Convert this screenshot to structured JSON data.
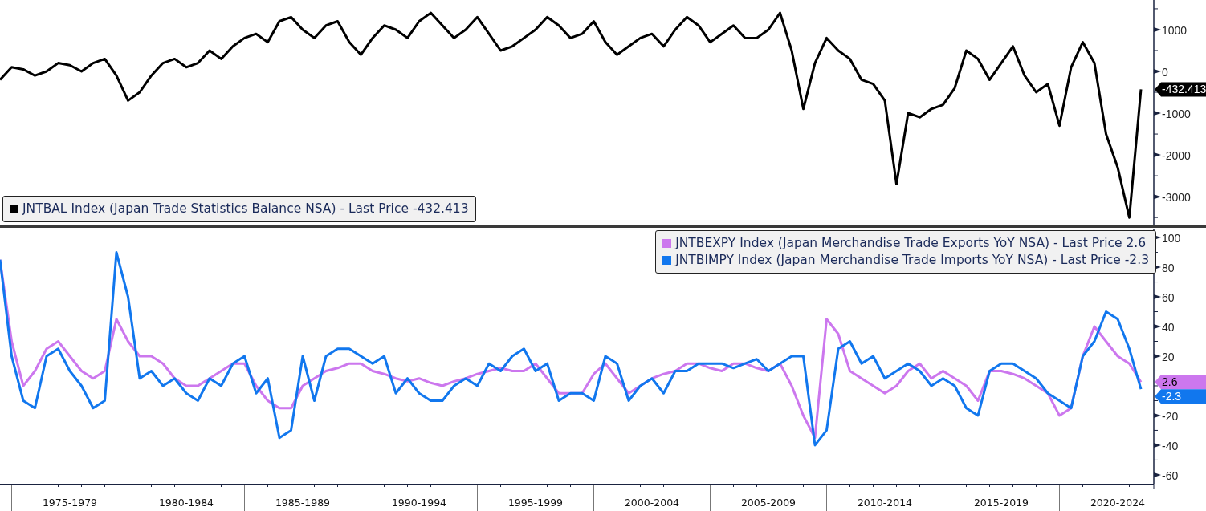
{
  "top_panel": {
    "legend": [
      {
        "text": "(Japan Trade Statistics Balance NSA) - Last Price -432.413"
      }
    ],
    "last_price_tags": [
      {
        "text": "-432.413",
        "color": "#000000"
      }
    ],
    "chart_data": {
      "type": "line",
      "categories": [
        null,
        null,
        null,
        null,
        null,
        null,
        null,
        null,
        null,
        null,
        null,
        null,
        null,
        null,
        null,
        null,
        null,
        null,
        null,
        null,
        null,
        null,
        null,
        null,
        null,
        null,
        null,
        null,
        null,
        null,
        null,
        null,
        null,
        null,
        null,
        null,
        null,
        null,
        null,
        null,
        null,
        null,
        null,
        null,
        null,
        null,
        null,
        null,
        null,
        null,
        null,
        null,
        null,
        null,
        null,
        null,
        null,
        null,
        null,
        null,
        null,
        null,
        null,
        null,
        null,
        null,
        null,
        null,
        null,
        null,
        null,
        null,
        null,
        null,
        null,
        null,
        null,
        null,
        null,
        null,
        null,
        null,
        null,
        null,
        null,
        null,
        null,
        null,
        null,
        null,
        null,
        null,
        null,
        null,
        null,
        null,
        null,
        null,
        null
      ],
      "series": [
        {
          "name": "JNTBAL Index",
          "color": "#000000",
          "values": [
            -200,
            100,
            50,
            -100,
            0,
            200,
            150,
            0,
            200,
            300,
            -100,
            -700,
            -500,
            -100,
            200,
            300,
            100,
            200,
            500,
            300,
            600,
            800,
            900,
            700,
            1200,
            1300,
            1000,
            800,
            1100,
            1200,
            700,
            400,
            800,
            1100,
            1000,
            800,
            1200,
            1400,
            1100,
            800,
            1000,
            1300,
            900,
            500,
            600,
            800,
            1000,
            1300,
            1100,
            800,
            900,
            1200,
            700,
            400,
            600,
            800,
            900,
            600,
            1000,
            1300,
            1100,
            700,
            900,
            1100,
            800,
            800,
            1000,
            1400,
            500,
            -900,
            200,
            800,
            500,
            300,
            -200,
            -300,
            -700,
            -2700,
            -1000,
            -1100,
            -900,
            -800,
            -400,
            500,
            300,
            -200,
            200,
            600,
            -100,
            -500,
            -300,
            -1300,
            100,
            700,
            200,
            -1500,
            -2300,
            -3500,
            -430
          ]
        }
      ],
      "ylim": [
        -3670,
        1710
      ],
      "yticks": [
        1000,
        0,
        -1000,
        -2000,
        -3000
      ]
    }
  },
  "bottom_panel": {
    "legend": [
      {
        "text": "(Japan Merchandise Trade Exports YoY NSA) - Last Price 2.6"
      },
      {
        "text": "(Japan Merchandise Trade Imports YoY NSA) - Last Price -2.3"
      }
    ],
    "last_price_tags": [
      {
        "text": "2.6",
        "color": "#cc77ee"
      },
      {
        "text": "-2.3",
        "color": "#1177ee"
      }
    ],
    "chart_data": {
      "type": "line",
      "categories": [
        null,
        null,
        null,
        null,
        null,
        null,
        "1975-1979",
        null,
        null,
        null,
        null,
        null,
        null,
        null,
        null,
        null,
        "1980-1984",
        null,
        null,
        null,
        null,
        null,
        null,
        null,
        null,
        null,
        "1985-1989",
        null,
        null,
        null,
        null,
        null,
        null,
        null,
        null,
        null,
        "1990-1994",
        null,
        null,
        null,
        null,
        null,
        null,
        null,
        null,
        null,
        "1995-1999",
        null,
        null,
        null,
        null,
        null,
        null,
        null,
        null,
        null,
        "2000-2004",
        null,
        null,
        null,
        null,
        null,
        null,
        null,
        null,
        null,
        "2005-2009",
        null,
        null,
        null,
        null,
        null,
        null,
        null,
        null,
        null,
        "2010-2014",
        null,
        null,
        null,
        null,
        null,
        null,
        null,
        null,
        null,
        "2015-2019",
        null,
        null,
        null,
        null,
        null,
        null,
        null,
        null,
        null,
        "2020-2024",
        null,
        null
      ],
      "series": [
        {
          "name": "JNTBEXPY Index",
          "color": "#cc77ee",
          "values": [
            85,
            30,
            0,
            10,
            25,
            30,
            20,
            10,
            5,
            10,
            45,
            30,
            20,
            20,
            15,
            5,
            0,
            0,
            5,
            10,
            15,
            15,
            0,
            -10,
            -15,
            -15,
            0,
            5,
            10,
            12,
            15,
            15,
            10,
            8,
            5,
            3,
            5,
            2,
            0,
            3,
            5,
            8,
            10,
            12,
            10,
            10,
            15,
            5,
            -5,
            -5,
            -5,
            8,
            15,
            5,
            -5,
            0,
            5,
            8,
            10,
            15,
            15,
            12,
            10,
            15,
            15,
            12,
            10,
            15,
            0,
            -20,
            -35,
            45,
            35,
            10,
            5,
            0,
            -5,
            0,
            10,
            15,
            5,
            10,
            5,
            0,
            -10,
            10,
            10,
            8,
            5,
            0,
            -5,
            -20,
            -15,
            20,
            40,
            30,
            20,
            15,
            2.6
          ]
        },
        {
          "name": "JNTBIMPY Index",
          "color": "#1177ee",
          "values": [
            85,
            20,
            -10,
            -15,
            20,
            25,
            10,
            0,
            -15,
            -10,
            90,
            60,
            5,
            10,
            0,
            5,
            -5,
            -10,
            5,
            0,
            15,
            20,
            -5,
            5,
            -35,
            -30,
            20,
            -10,
            20,
            25,
            25,
            20,
            15,
            20,
            -5,
            5,
            -5,
            -10,
            -10,
            0,
            5,
            0,
            15,
            10,
            20,
            25,
            10,
            15,
            -10,
            -5,
            -5,
            -10,
            20,
            15,
            -10,
            0,
            5,
            -5,
            10,
            10,
            15,
            15,
            15,
            12,
            15,
            18,
            10,
            15,
            20,
            20,
            -40,
            -30,
            25,
            30,
            15,
            20,
            5,
            10,
            15,
            10,
            0,
            5,
            0,
            -15,
            -20,
            10,
            15,
            15,
            10,
            5,
            -5,
            -10,
            -15,
            20,
            30,
            50,
            45,
            25,
            -2.3
          ]
        }
      ],
      "ylim": [
        -66,
        106
      ],
      "yticks": [
        100,
        80,
        60,
        40,
        20,
        -20,
        -40,
        -60
      ]
    }
  }
}
